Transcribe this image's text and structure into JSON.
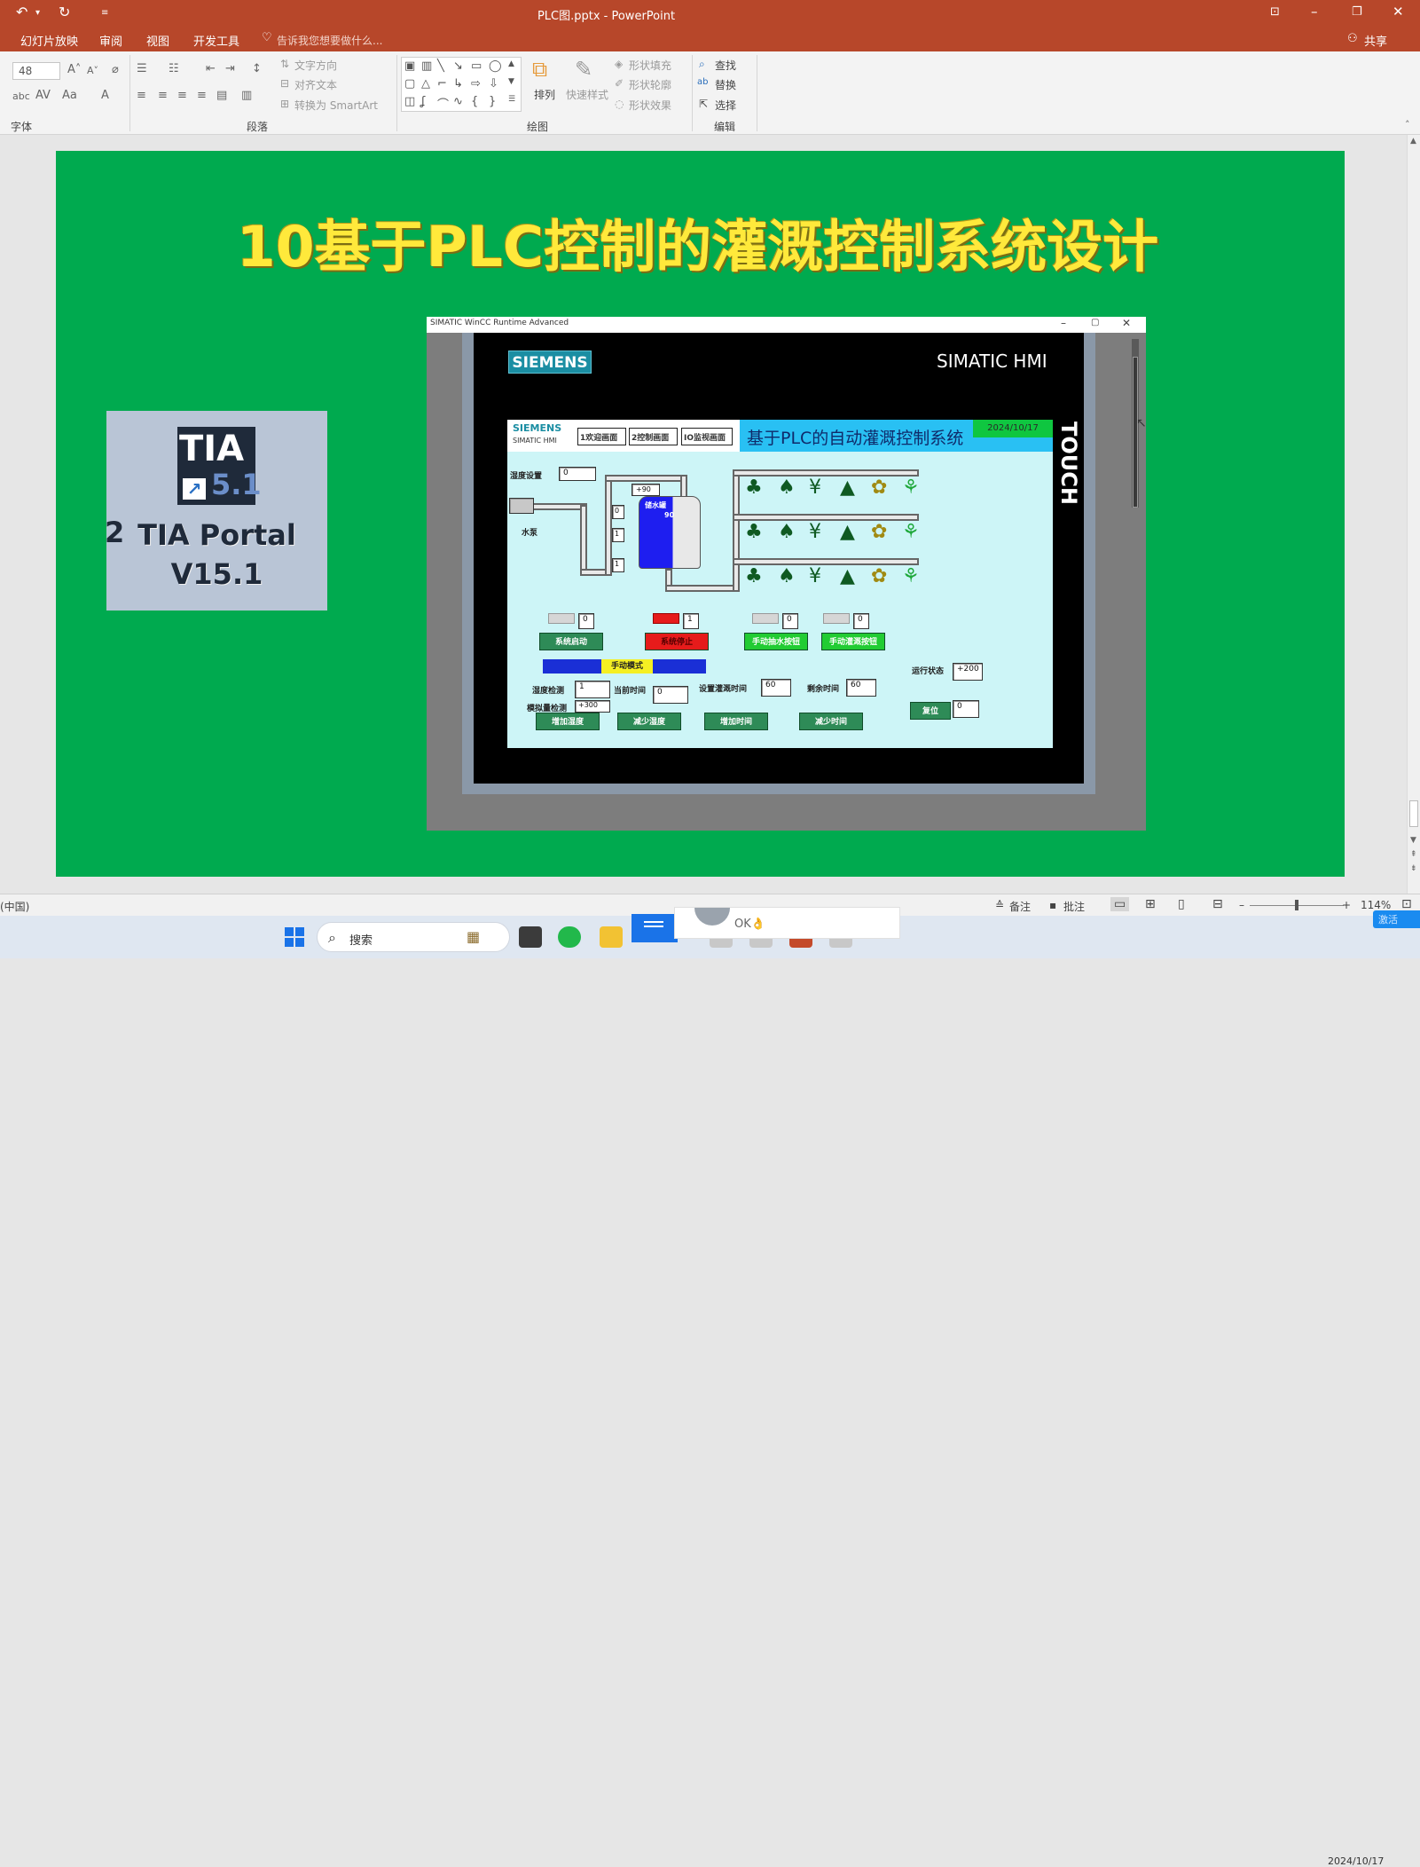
{
  "titlebar": {
    "doc_title": "PLC图.pptx - PowerPoint",
    "undo_icon": "undo-icon",
    "redo_icon": "redo-icon",
    "customize_icon": "customize-qat-icon",
    "window_controls": [
      "ribbon-display-options",
      "minimize",
      "restore",
      "close"
    ]
  },
  "tabs": {
    "items": [
      "幻灯片放映",
      "审阅",
      "视图",
      "开发工具"
    ],
    "tell_me": "告诉我您想要做什么...",
    "share": "共享"
  },
  "ribbon": {
    "font_size": "48",
    "groups": {
      "font": "字体",
      "paragraph": "段落",
      "drawing": "绘图",
      "editing": "编辑"
    },
    "paragraph": {
      "text_direction": "文字方向",
      "align_text": "对齐文本",
      "smartart": "转换为 SmartArt"
    },
    "drawing": {
      "arrange": "排列",
      "quick_styles": "快速样式",
      "shape_fill": "形状填充",
      "shape_outline": "形状轮廓",
      "shape_effects": "形状效果"
    },
    "editing": {
      "find": "查找",
      "replace": "替换",
      "select": "选择"
    }
  },
  "slide": {
    "title": "10基于PLC控制的灌溉控制系统设计",
    "tia": {
      "logo_top": "TIA",
      "logo_version": "5.1",
      "name_line1": "TIA Portal",
      "name_line2": "V15.1",
      "side_char": "2"
    },
    "wincc": {
      "window_title": "SIMATIC WinCC Runtime Advanced",
      "siemens": "SIEMENS",
      "simatic_hmi": "SIMATIC HMI",
      "touch": "TOUCH",
      "screen": {
        "logo": "SIEMENS",
        "logo_sub": "SIMATIC HMI",
        "nav": [
          "1欢迎画面",
          "2控制画面",
          "IO监视画面"
        ],
        "system_title": "基于PLC的自动灌溉控制系统",
        "date": "2024/10/17",
        "humidity_setting_label": "湿度设置",
        "humidity_setting_value": "0",
        "pump_label": "水泵",
        "tank_label": "储水罐",
        "tank_value": "90",
        "plus90": "+90",
        "pipe_values": [
          "0",
          "1",
          "1"
        ],
        "lamps": [
          {
            "value": "0",
            "color": "gray"
          },
          {
            "value": "1",
            "color": "red"
          },
          {
            "value": "0",
            "color": "gray"
          },
          {
            "value": "0",
            "color": "gray"
          }
        ],
        "buttons_row1": [
          "系统启动",
          "系统停止",
          "手动抽水按钮",
          "手动灌溉按钮"
        ],
        "mode": "手动模式",
        "run_state_label": "运行状态",
        "run_state_value": "+200",
        "humidity_detect_label": "湿度检测",
        "humidity_detect_value": "1",
        "current_time_label": "当前时间",
        "current_time_value": "0",
        "set_irrigation_time_label": "设置灌溉时间",
        "set_irrigation_time_value": "60",
        "remaining_time_label": "剩余时间",
        "remaining_time_value": "60",
        "analog_detect_label": "模拟量检测",
        "analog_detect_value": "+300",
        "reset_label": "复位",
        "reset_value": "0",
        "buttons_row2": [
          "增加湿度",
          "减少湿度",
          "增加时间",
          "减少时间"
        ]
      }
    }
  },
  "statusbar": {
    "language": "(中国)",
    "notes": "备注",
    "comments": "批注",
    "zoom": "114%"
  },
  "taskbar": {
    "search": "搜索",
    "chat_text": "OK👌",
    "date": "2024/10/17",
    "activate": "激活"
  },
  "colors": {
    "ppt_accent": "#b7472a",
    "slide_bg": "#00aa4f",
    "title_yellow": "#ffe93b"
  }
}
